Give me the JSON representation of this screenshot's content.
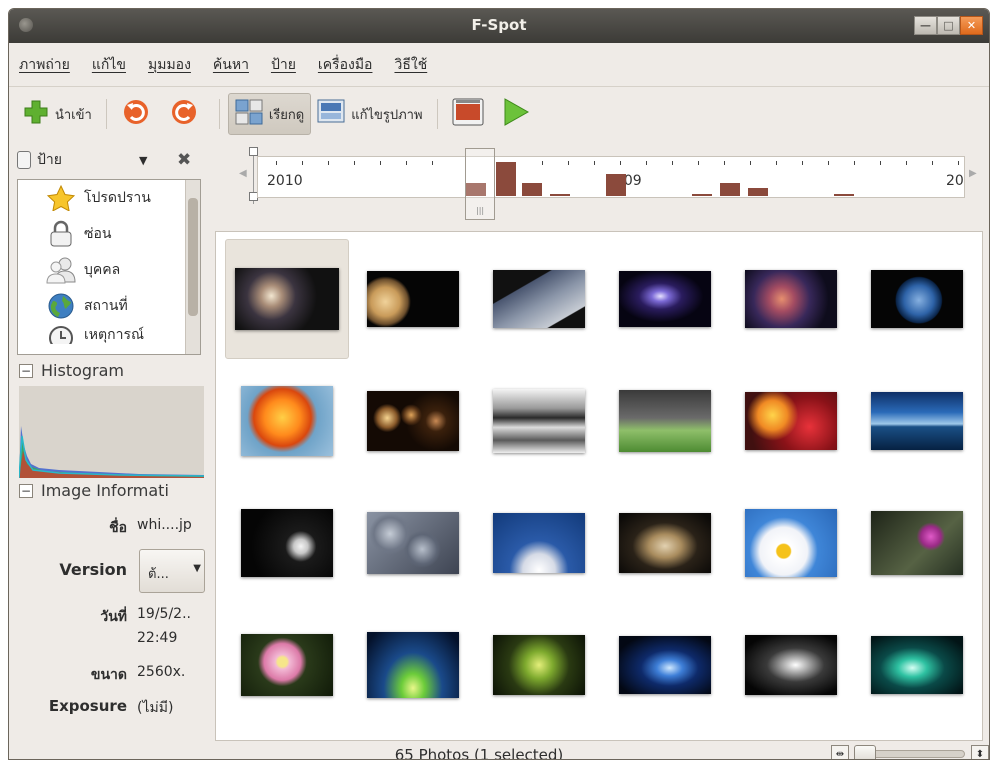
{
  "window": {
    "title": "F-Spot"
  },
  "menubar": [
    "ภาพถ่าย",
    "แก้ไข",
    "มุมมอง",
    "ค้นหา",
    "ป้าย",
    "เครื่องมือ",
    "วิธีใช้"
  ],
  "toolbar": {
    "import_label": "นำเข้า",
    "browse_label": "เรียกดู",
    "edit_label": "แก้ไขรูปภาพ"
  },
  "tags": {
    "header": "ป้าย",
    "items": [
      {
        "label": "โปรดปราน",
        "icon": "star-icon"
      },
      {
        "label": "ซ่อน",
        "icon": "lock-icon"
      },
      {
        "label": "บุคคล",
        "icon": "people-icon"
      },
      {
        "label": "สถานที่",
        "icon": "globe-icon"
      },
      {
        "label": "เหตุการณ์",
        "icon": "clock-icon"
      }
    ]
  },
  "histogram": {
    "title": "Histogram"
  },
  "image_info": {
    "title": "Image Informati",
    "name_label": "ชื่อ",
    "name_value": "whi....jp",
    "version_label": "Version",
    "version_value": "ต้...",
    "date_label": "วันที่",
    "date_value": "19/5/2..",
    "time_value": "22:49",
    "size_label": "ขนาด",
    "size_value": "2560x.",
    "exposure_label": "Exposure",
    "exposure_value": "(ไม่มี)"
  },
  "timeline": {
    "labels": [
      "2010",
      "2009",
      "20"
    ]
  },
  "status": {
    "text": "65 Photos (1 selected)"
  },
  "photos": [
    "galaxy-spiral",
    "planet-jupiter",
    "planet-surface",
    "comet",
    "nebula",
    "earth",
    "orange-flower",
    "bokeh-lights",
    "chrome-metal",
    "green-lawn",
    "red-bokeh",
    "sunset-pier",
    "white-flower-dark",
    "pebbles",
    "dandelion",
    "dry-leaf",
    "daisy-sky",
    "pink-flowers",
    "pink-daisy",
    "green-light-tunnel",
    "tree-canopy",
    "blue-swirl",
    "white-swirl",
    "teal-swirl"
  ],
  "colors": {
    "accent": "#dd4814",
    "timeline_bar": "#8b4a3c"
  }
}
